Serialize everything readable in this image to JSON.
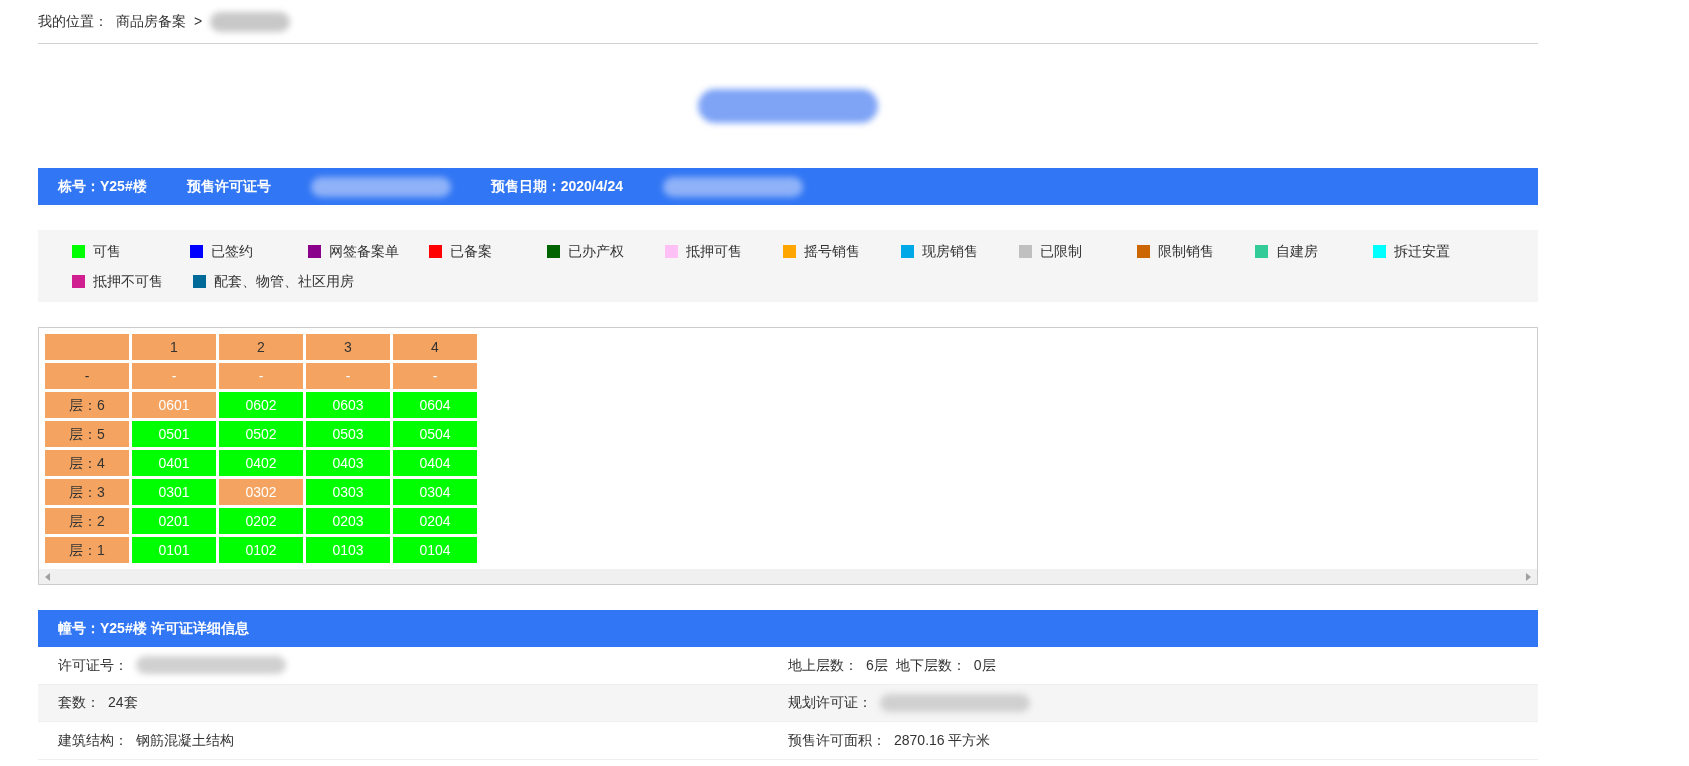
{
  "breadcrumb": {
    "label": "我的位置：",
    "items": [
      {
        "text": "商品房备案",
        "kind": "link"
      },
      {
        "text": ">",
        "kind": "separator"
      },
      {
        "kind": "redacted"
      }
    ]
  },
  "title": {
    "kind": "redacted"
  },
  "info_bar": [
    {
      "kind": "text",
      "text": "栋号：Y25#楼"
    },
    {
      "kind": "text",
      "text": "预售许可证号"
    },
    {
      "kind": "redacted"
    },
    {
      "kind": "text",
      "text": "预售日期：2020/4/24"
    },
    {
      "kind": "redacted"
    }
  ],
  "legend": [
    {
      "label": "可售",
      "color": "#00ff00"
    },
    {
      "label": "已签约",
      "color": "#0000ff"
    },
    {
      "label": "网签备案单",
      "color": "#8b008b"
    },
    {
      "label": "已备案",
      "color": "#ff0000"
    },
    {
      "label": "已办产权",
      "color": "#006400"
    },
    {
      "label": "抵押可售",
      "color": "#ffc0f5"
    },
    {
      "label": "摇号销售",
      "color": "#ffa500"
    },
    {
      "label": "现房销售",
      "color": "#00a8e8"
    },
    {
      "label": "已限制",
      "color": "#c0c0c0"
    },
    {
      "label": "限制销售",
      "color": "#cc6600"
    },
    {
      "label": "自建房",
      "color": "#33cc99"
    },
    {
      "label": "拆迁安置",
      "color": "#00ffff"
    },
    {
      "label": "抵押不可售",
      "color": "#d02090"
    },
    {
      "label": "配套、物管、社区用房",
      "color": "#006b99"
    }
  ],
  "grid": {
    "columns": [
      "1",
      "2",
      "3",
      "4"
    ],
    "sub_header": [
      "-",
      "-",
      "-",
      "-",
      "-"
    ],
    "rows": [
      {
        "floor": "层：6",
        "units": [
          {
            "text": "0601",
            "color": "#f4a460"
          },
          {
            "text": "0602",
            "color": "#00ff00"
          },
          {
            "text": "0603",
            "color": "#00ff00"
          },
          {
            "text": "0604",
            "color": "#00ff00"
          }
        ]
      },
      {
        "floor": "层：5",
        "units": [
          {
            "text": "0501",
            "color": "#00ff00"
          },
          {
            "text": "0502",
            "color": "#00ff00"
          },
          {
            "text": "0503",
            "color": "#00ff00"
          },
          {
            "text": "0504",
            "color": "#00ff00"
          }
        ]
      },
      {
        "floor": "层：4",
        "units": [
          {
            "text": "0401",
            "color": "#00ff00"
          },
          {
            "text": "0402",
            "color": "#00ff00"
          },
          {
            "text": "0403",
            "color": "#00ff00"
          },
          {
            "text": "0404",
            "color": "#00ff00"
          }
        ]
      },
      {
        "floor": "层：3",
        "units": [
          {
            "text": "0301",
            "color": "#00ff00"
          },
          {
            "text": "0302",
            "color": "#f4a460"
          },
          {
            "text": "0303",
            "color": "#00ff00"
          },
          {
            "text": "0304",
            "color": "#00ff00"
          }
        ]
      },
      {
        "floor": "层：2",
        "units": [
          {
            "text": "0201",
            "color": "#00ff00"
          },
          {
            "text": "0202",
            "color": "#00ff00"
          },
          {
            "text": "0203",
            "color": "#00ff00"
          },
          {
            "text": "0204",
            "color": "#00ff00"
          }
        ]
      },
      {
        "floor": "层：1",
        "units": [
          {
            "text": "0101",
            "color": "#00ff00"
          },
          {
            "text": "0102",
            "color": "#00ff00"
          },
          {
            "text": "0103",
            "color": "#00ff00"
          },
          {
            "text": "0104",
            "color": "#00ff00"
          }
        ]
      }
    ]
  },
  "details": {
    "title": "幢号：Y25#楼 许可证详细信息",
    "rows": [
      [
        {
          "label": "许可证号：",
          "redacted": true
        },
        {
          "label": "地上层数：",
          "value": "6层",
          "label_2": "地下层数：",
          "value_2": "0层"
        }
      ],
      [
        {
          "label": "套数：",
          "value": "24套"
        },
        {
          "label": "规划许可证：",
          "redacted": true
        }
      ],
      [
        {
          "label": "建筑结构：",
          "value": "钢筋混凝土结构"
        },
        {
          "label": "预售许可面积：",
          "value": "2870.16 平方米"
        }
      ]
    ]
  }
}
